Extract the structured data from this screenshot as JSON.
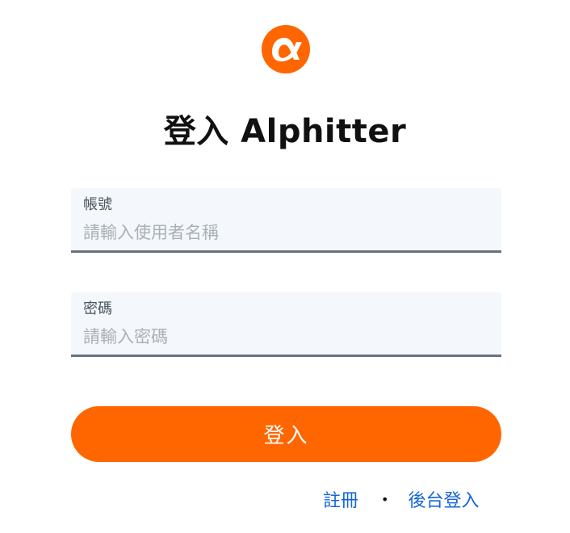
{
  "brand": {
    "logo_icon": "alpha-logo-icon",
    "accent_color": "#ff6600"
  },
  "header": {
    "title": "登入 Alphitter"
  },
  "form": {
    "username": {
      "label": "帳號",
      "placeholder": "請輸入使用者名稱",
      "value": ""
    },
    "password": {
      "label": "密碼",
      "placeholder": "請輸入密碼",
      "value": ""
    },
    "submit_label": "登入"
  },
  "footer": {
    "register_label": "註冊",
    "separator": "•",
    "admin_login_label": "後台登入",
    "link_color": "#1565d8"
  }
}
